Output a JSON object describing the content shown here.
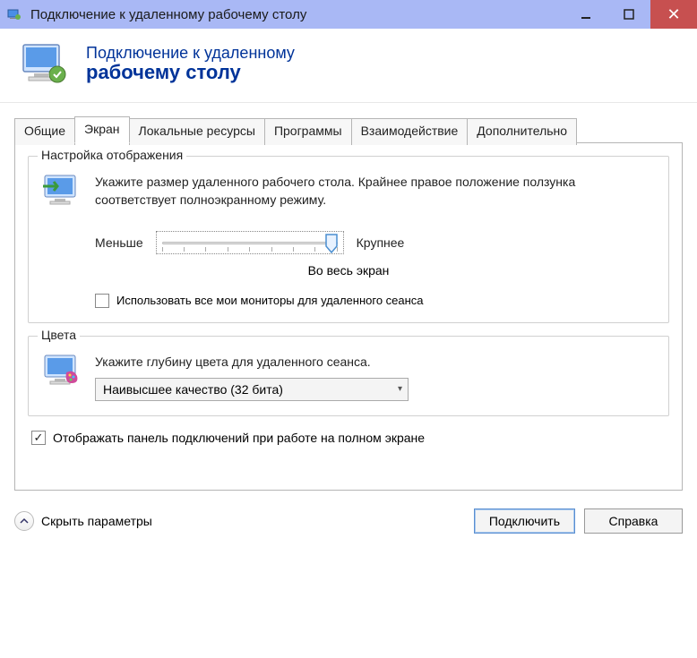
{
  "window": {
    "title": "Подключение к удаленному рабочему столу"
  },
  "header": {
    "line1": "Подключение к удаленному",
    "line2": "рабочему столу"
  },
  "tabs": [
    "Общие",
    "Экран",
    "Локальные ресурсы",
    "Программы",
    "Взаимодействие",
    "Дополнительно"
  ],
  "active_tab_index": 1,
  "display_group": {
    "title": "Настройка отображения",
    "description": "Укажите размер удаленного рабочего стола. Крайнее правое положение ползунка соответствует полноэкранному режиму.",
    "label_min": "Меньше",
    "label_max": "Крупнее",
    "slider_caption": "Во весь экран",
    "multi_monitor_label": "Использовать все мои мониторы для удаленного сеанса",
    "multi_monitor_checked": false
  },
  "colors_group": {
    "title": "Цвета",
    "description": "Укажите глубину цвета для удаленного сеанса.",
    "selected": "Наивысшее качество (32 бита)"
  },
  "connection_bar": {
    "label": "Отображать панель подключений при работе на полном экране",
    "checked": true
  },
  "footer": {
    "collapse": "Скрыть параметры",
    "connect": "Подключить",
    "help": "Справка"
  }
}
